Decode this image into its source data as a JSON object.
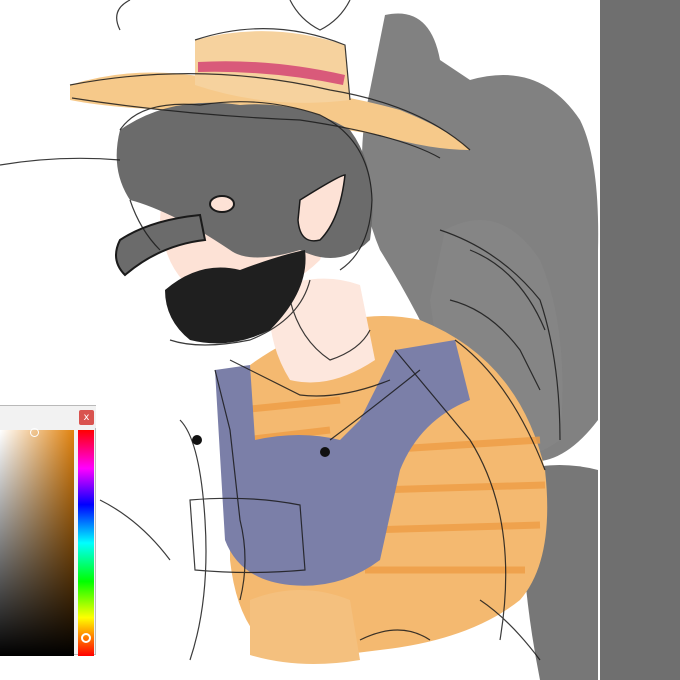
{
  "color_picker": {
    "close_label": "x",
    "selected_color": "#e08a1e",
    "hue_fraction": 0.92
  },
  "colors": {
    "side_panel": "#6f6f6f",
    "shadow_gray": "#6b6b6b",
    "wing_gray": "#7d7d7d",
    "hat_straw": "#f6c98a",
    "hat_band": "#d95a7a",
    "skin": "#fde2d6",
    "overalls": "#7b7fa8",
    "shirt_orange": "#f4b970",
    "line_ink": "#1a1a1a"
  },
  "icons": {
    "close": "close-icon"
  }
}
